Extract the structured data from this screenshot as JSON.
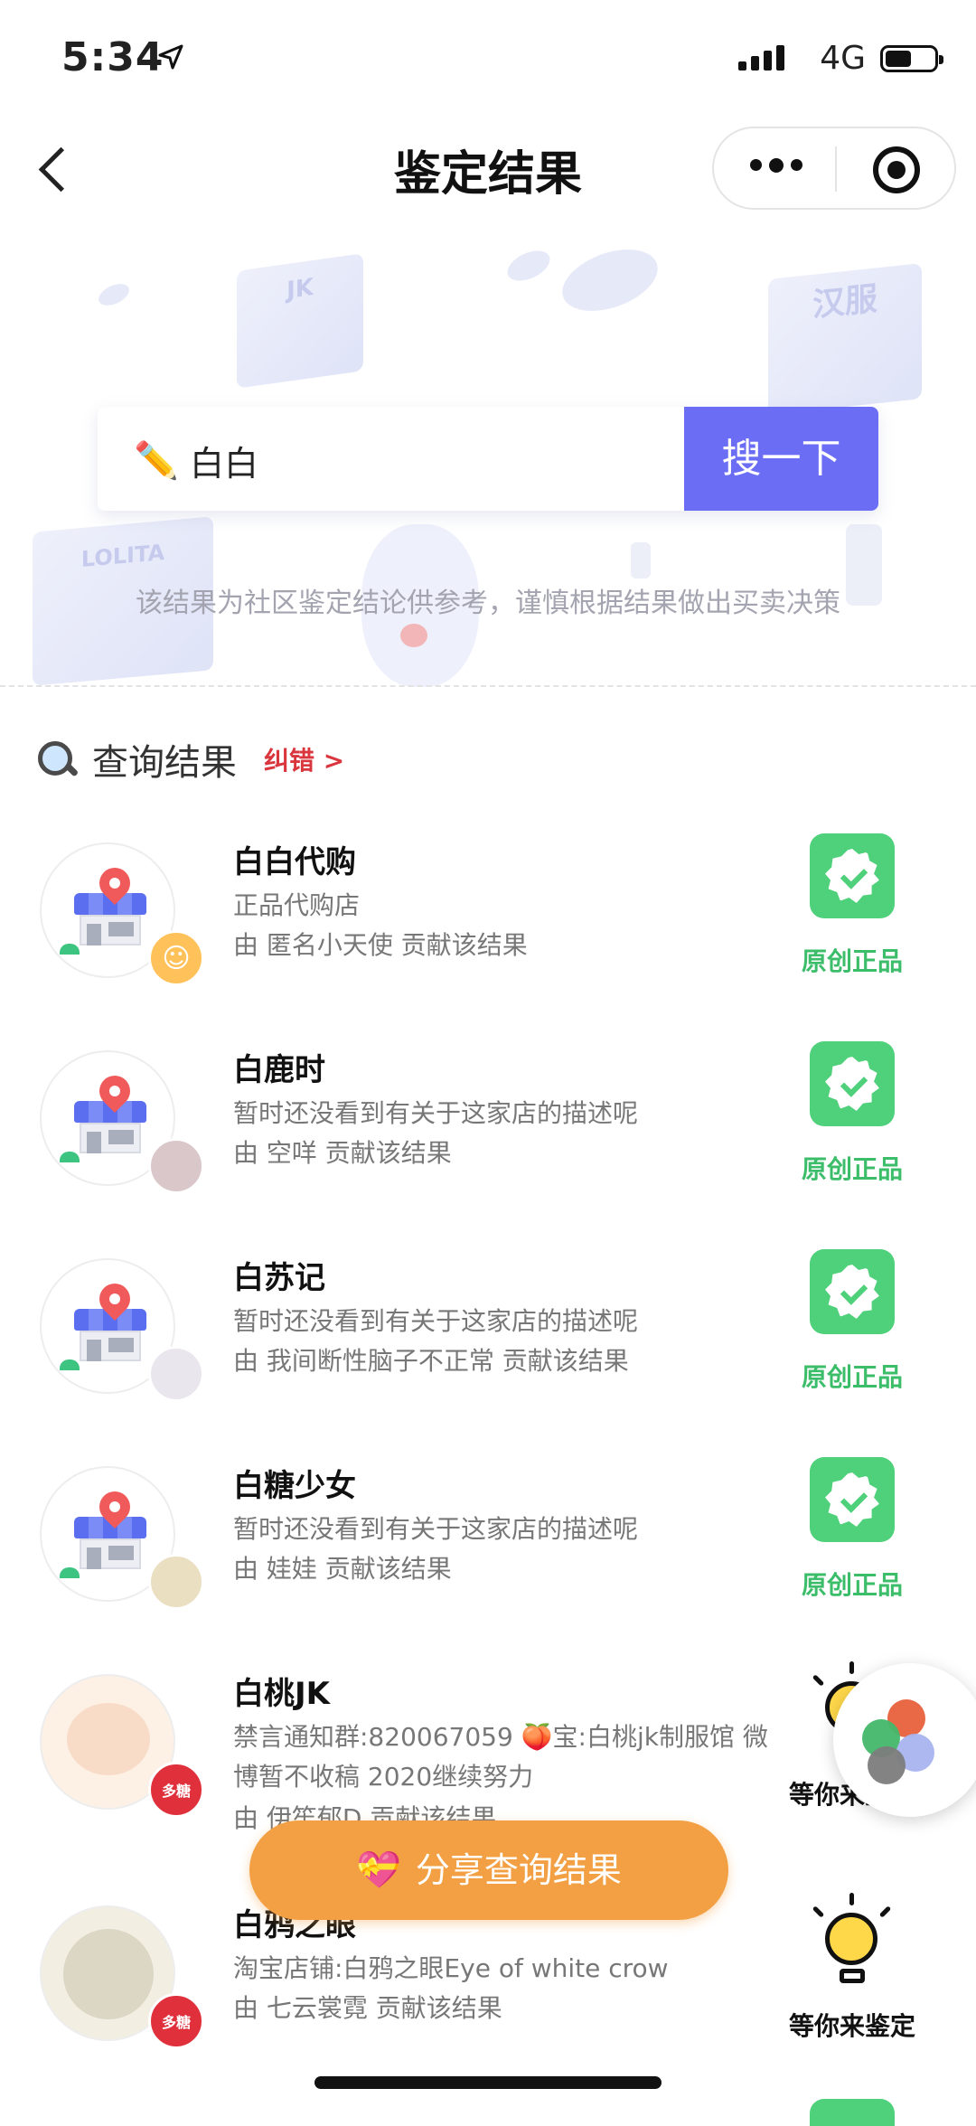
{
  "status_bar": {
    "time": "5:34",
    "network": "4G"
  },
  "nav": {
    "title": "鉴定结果"
  },
  "hero": {
    "cube_labels": [
      "JK",
      "汉服",
      "LOLITA"
    ],
    "search_value": "白白",
    "search_button": "搜一下",
    "disclaimer": "该结果为社区鉴定结论供参考，谨慎根据结果做出买卖决策"
  },
  "results_header": {
    "title": "查询结果",
    "correction_link": "纠错 >"
  },
  "results": [
    {
      "name": "白白代购",
      "desc": "正品代购店",
      "contributor": "由 匿名小天使 贡献该结果",
      "status": "原创正品",
      "status_type": "verified"
    },
    {
      "name": "白鹿时",
      "desc": "暂时还没看到有关于这家店的描述呢",
      "contributor": "由 空咩 贡献该结果",
      "status": "原创正品",
      "status_type": "verified"
    },
    {
      "name": "白苏记",
      "desc": "暂时还没看到有关于这家店的描述呢",
      "contributor": "由 我间断性脑子不正常 贡献该结果",
      "status": "原创正品",
      "status_type": "verified"
    },
    {
      "name": "白糖少女",
      "desc": "暂时还没看到有关于这家店的描述呢",
      "contributor": "由 娃娃 贡献该结果",
      "status": "原创正品",
      "status_type": "verified"
    },
    {
      "name": "白桃JK",
      "desc": "禁言通知群:820067059 🍑宝:白桃jk制服馆 微博暂不收稿 2020继续努力",
      "contributor": "由 伊笙郁D 贡献该结果",
      "status": "等你来鉴定",
      "status_type": "pending",
      "tag": "多糖"
    },
    {
      "name": "白鸦之眼",
      "desc": "淘宝店铺:白鸦之眼Eye of white crow",
      "contributor": "由 七云裳霓 贡献该结果",
      "status": "等你来鉴定",
      "status_type": "pending",
      "tag": "多糖"
    }
  ],
  "share_button": "分享查询结果",
  "colors": {
    "accent": "#6b6ef5",
    "verified": "#4fd07a",
    "share": "#f2a043",
    "correction": "#d9363e"
  }
}
